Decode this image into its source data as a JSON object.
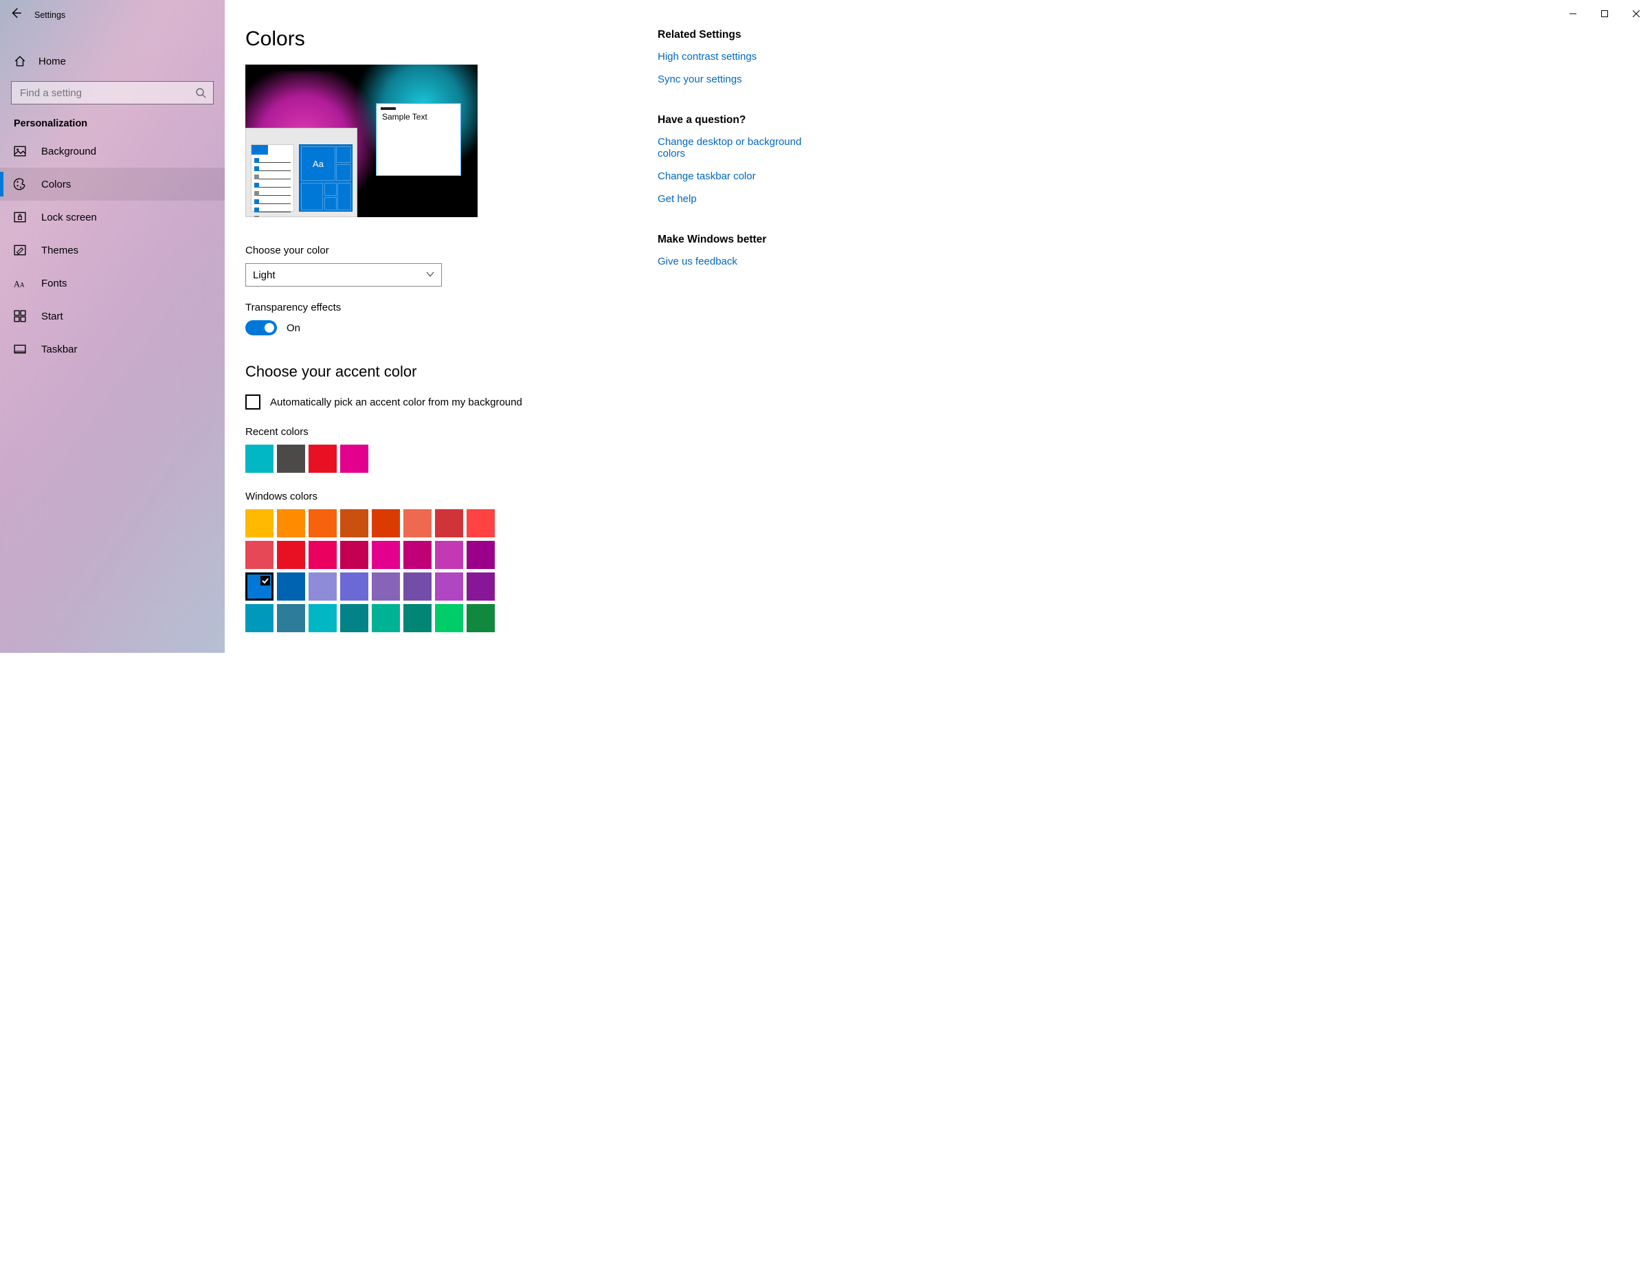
{
  "app": {
    "title": "Settings"
  },
  "windowControls": {
    "min": "—",
    "max": "▢",
    "close": "✕"
  },
  "sidebar": {
    "home": "Home",
    "search_placeholder": "Find a setting",
    "category": "Personalization",
    "items": [
      {
        "label": "Background",
        "icon": "picture"
      },
      {
        "label": "Colors",
        "icon": "palette",
        "active": true
      },
      {
        "label": "Lock screen",
        "icon": "lock"
      },
      {
        "label": "Themes",
        "icon": "brush"
      },
      {
        "label": "Fonts",
        "icon": "font"
      },
      {
        "label": "Start",
        "icon": "start"
      },
      {
        "label": "Taskbar",
        "icon": "taskbar"
      }
    ]
  },
  "page": {
    "title": "Colors",
    "preview_sample": "Sample Text",
    "preview_aa": "Aa",
    "choose_color_label": "Choose your color",
    "choose_color_value": "Light",
    "transparency_label": "Transparency effects",
    "transparency_state": "On",
    "accent_heading": "Choose your accent color",
    "auto_pick_label": "Automatically pick an accent color from my background",
    "recent_label": "Recent colors",
    "recent_colors": [
      "#00b7c3",
      "#4c4a48",
      "#e81123",
      "#e3008c"
    ],
    "windows_label": "Windows colors",
    "windows_colors": [
      "#ffb900",
      "#ff8c00",
      "#f7630c",
      "#ca5010",
      "#da3b01",
      "#ef6950",
      "#d13438",
      "#ff4343",
      "#e74856",
      "#e81123",
      "#ea005e",
      "#c30052",
      "#e3008c",
      "#bf0077",
      "#c239b3",
      "#9a0089",
      "#0078d7",
      "#0063b1",
      "#8e8cd8",
      "#6b69d6",
      "#8764b8",
      "#744da9",
      "#b146c2",
      "#881798",
      "#0099bc",
      "#2d7d9a",
      "#00b7c3",
      "#038387",
      "#00b294",
      "#018574",
      "#00cc6a",
      "#10893e"
    ],
    "selected_color_index": 16
  },
  "related": {
    "heading": "Related Settings",
    "links": [
      "High contrast settings",
      "Sync your settings"
    ]
  },
  "question": {
    "heading": "Have a question?",
    "links": [
      "Change desktop or background colors",
      "Change taskbar color",
      "Get help"
    ]
  },
  "feedback": {
    "heading": "Make Windows better",
    "links": [
      "Give us feedback"
    ]
  }
}
